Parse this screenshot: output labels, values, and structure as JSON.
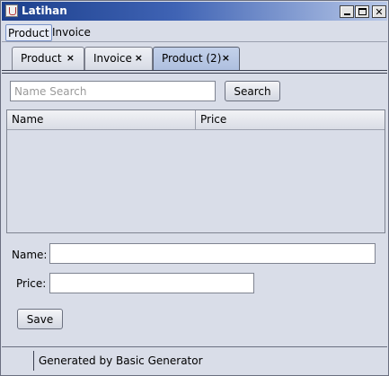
{
  "window": {
    "title": "Latihan"
  },
  "menu": {
    "items": [
      {
        "label": "Product"
      },
      {
        "label": "Invoice"
      }
    ]
  },
  "tabs": [
    {
      "label": "Product",
      "close": "×"
    },
    {
      "label": "Invoice",
      "close": "×"
    },
    {
      "label": "Product (2)",
      "close": "×",
      "selected": true
    }
  ],
  "search": {
    "placeholder": "Name Search",
    "value": "",
    "button_label": "Search"
  },
  "table": {
    "columns": [
      "Name",
      "Price"
    ],
    "rows": []
  },
  "form": {
    "name_label": "Name:",
    "name_value": "",
    "price_label": "Price:",
    "price_value": "",
    "save_label": "Save"
  },
  "status": {
    "text": "Generated by Basic Generator"
  },
  "colors": {
    "titlebar_start": "#1c3f8c",
    "selected_tab": "#aebfdf",
    "background": "#d9dde8"
  }
}
